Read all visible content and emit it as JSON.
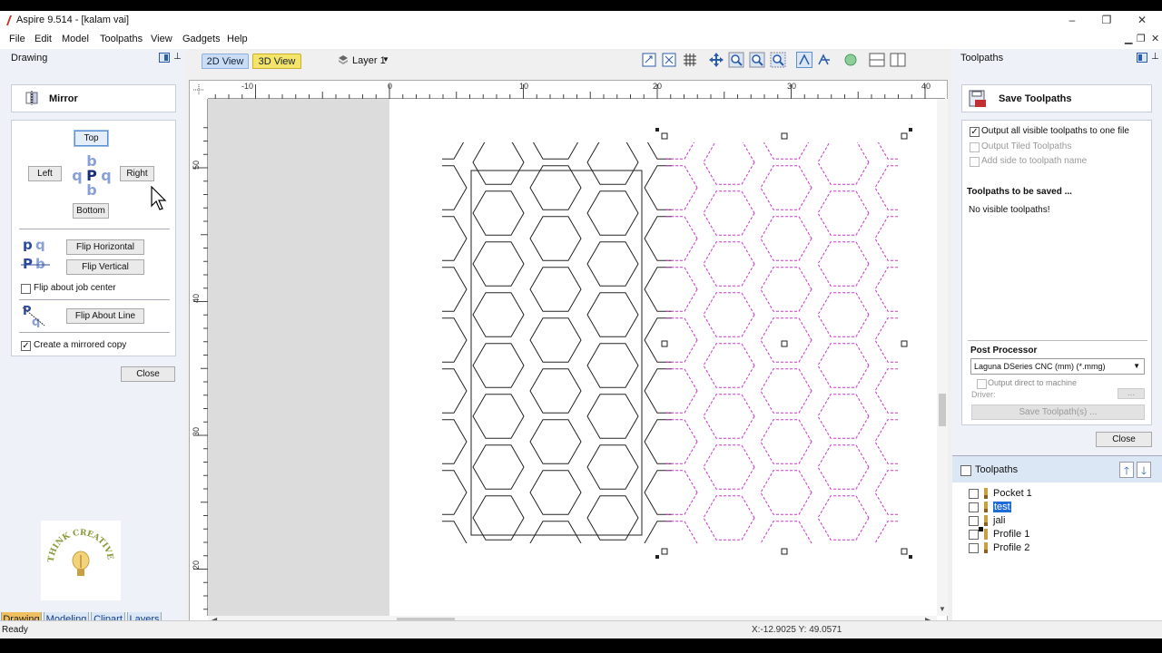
{
  "window": {
    "title": "Aspire 9.514 - [kalam vai]"
  },
  "menu": [
    "File",
    "Edit",
    "Model",
    "Toolpaths",
    "View",
    "Gadgets",
    "Help"
  ],
  "left_panel": {
    "header": "Drawing",
    "mirror": {
      "title": "Mirror",
      "top": "Top",
      "left": "Left",
      "right": "Right",
      "bottom": "Bottom",
      "flip_horizontal": "Flip Horizontal",
      "flip_vertical": "Flip Vertical",
      "flip_job_center": "Flip about job center",
      "flip_about_line": "Flip About Line",
      "mirrored_copy": "Create a mirrored copy",
      "mirrored_copy_checked": true,
      "close": "Close"
    },
    "logo_text": "THINK CREATIVE",
    "tabs": [
      "Drawing",
      "Modeling",
      "Clipart",
      "Layers"
    ]
  },
  "view": {
    "tab_2d": "2D View",
    "tab_3d": "3D View",
    "layer": "Layer 1",
    "ruler_top": [
      "-10",
      "0",
      "10",
      "20",
      "30",
      "40"
    ],
    "ruler_left": [
      "50",
      "40",
      "30",
      "20"
    ]
  },
  "right_panel": {
    "header": "Toolpaths",
    "save_title": "Save Toolpaths",
    "opt_all_visible": "Output all visible toolpaths to one file",
    "opt_tiled": "Output Tiled Toolpaths",
    "opt_side": "Add side to toolpath name",
    "to_save_title": "Toolpaths to be saved ...",
    "no_visible": "No visible toolpaths!",
    "post_processor_title": "Post Processor",
    "post_processor_value": "Laguna DSeries CNC (mm) (*.mmg)",
    "output_direct": "Output direct to machine",
    "driver_label": "Driver:",
    "driver_btn": "...",
    "save_btn": "Save Toolpath(s) ...",
    "close": "Close",
    "list_title": "Toolpaths",
    "list": [
      "Pocket 1",
      "test",
      "jali",
      "Profile 1",
      "Profile 2"
    ]
  },
  "status": {
    "left": "Ready",
    "coords": "X:-12.9025 Y: 49.0571"
  },
  "colors": {
    "accent_tab": "#f0c060",
    "mirror_copy": "#cc33cc",
    "selection_handle": "#222222"
  }
}
